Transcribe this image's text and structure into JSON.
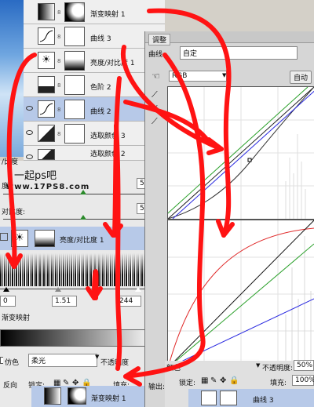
{
  "layers": [
    {
      "name": "渐变映射 1"
    },
    {
      "name": "曲线 3"
    },
    {
      "name": "亮度/对比度 1"
    },
    {
      "name": "色阶 2"
    },
    {
      "name": "曲线 2",
      "selected": true
    },
    {
      "name": "选取颜色 3"
    },
    {
      "name": "选取颜色 2"
    }
  ],
  "brightness_contrast": {
    "label_partial_top": "/比度",
    "label_brightness_partial": "度:",
    "brightness_value": "5",
    "label_contrast_partial": "对比度:",
    "contrast_value": "5",
    "layer_name": "亮度/对比度 1"
  },
  "levels": {
    "low": "0",
    "mid": "1.51",
    "high": "244"
  },
  "gradient_map_label": "渐变映射",
  "blend": {
    "dither_label": "仿色",
    "reverse_label": "反向",
    "mode": "柔光",
    "opacity_label": "不透明度",
    "lock_label": "锁定:",
    "fill_label": "填充:",
    "layer_name": "渐变映射 1"
  },
  "watermark": {
    "line1": "一起ps吧",
    "line2": "www.17PS8.com"
  },
  "curves_panel": {
    "tab_title": "调整",
    "curves_label": "曲线",
    "preset": "自定",
    "channel": "RGB",
    "auto_button": "自动",
    "color_mode_label": "颜色",
    "opacity_label": "不透明度:",
    "opacity_value": "50%",
    "lock_label": "锁定:",
    "fill_label": "填充:",
    "fill_value": "100%",
    "output_label": "输出:",
    "bottom_layer_name": "曲线 3"
  }
}
